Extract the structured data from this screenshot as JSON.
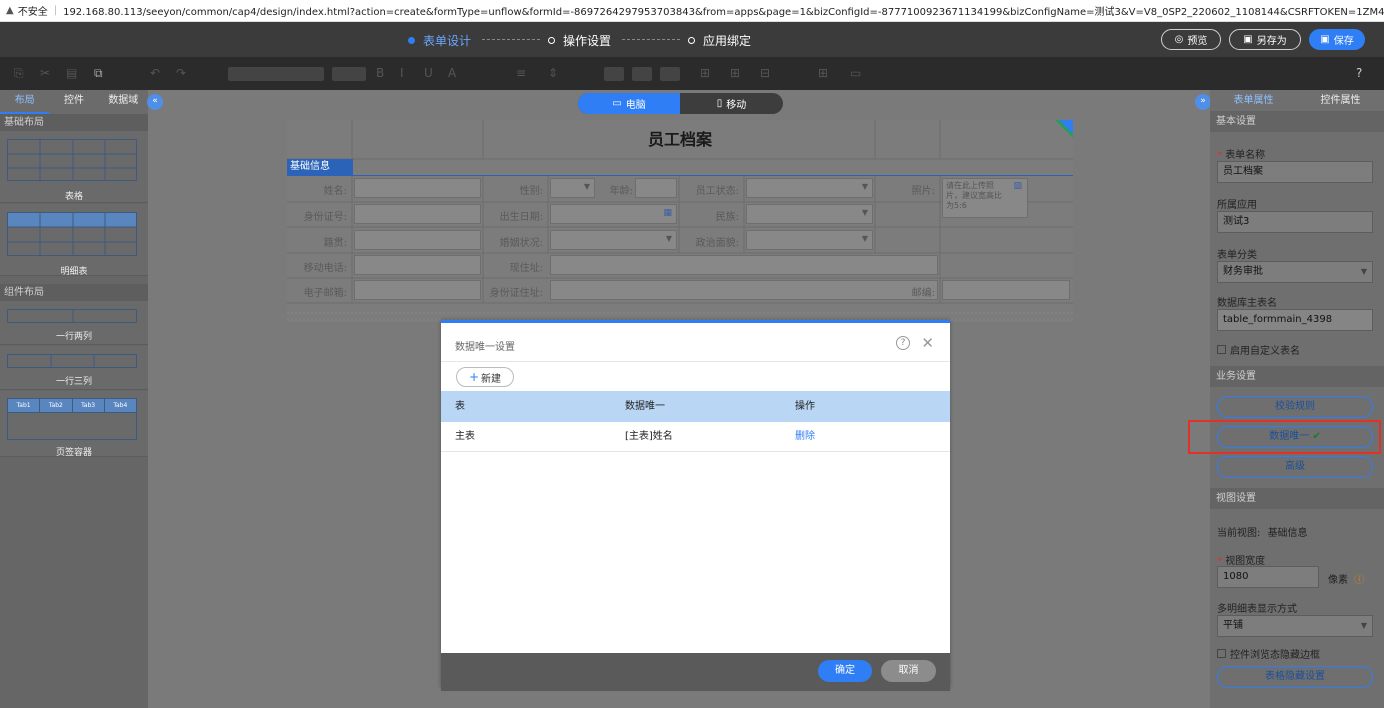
{
  "browser": {
    "security_label": "不安全",
    "url": "192.168.80.113/seeyon/common/cap4/design/index.html?action=create&formType=unflow&formId=-8697264297953703843&from=apps&page=1&bizConfigId=-8777100923671134199&bizConfigName=测试3&V=V8_0SP2_220602_1108144&CSRFTOKEN=1ZM4-..."
  },
  "steps": [
    {
      "label": "表单设计",
      "active": true
    },
    {
      "label": "操作设置",
      "active": false
    },
    {
      "label": "应用绑定",
      "active": false
    }
  ],
  "top_buttons": {
    "preview": "预览",
    "save_as": "另存为",
    "save": "保存"
  },
  "left_panel": {
    "tabs": [
      "布局",
      "控件",
      "数据域"
    ],
    "section_basic": "基础布局",
    "item_table": "表格",
    "item_detail_table": "明细表",
    "section_component": "组件布局",
    "item_two_col": "一行两列",
    "item_three_col": "一行三列",
    "tab_labels": [
      "Tab1",
      "Tab2",
      "Tab3",
      "Tab4"
    ],
    "item_tab_container": "页签容器"
  },
  "device_toggle": {
    "pc": "电脑",
    "mobile": "移动"
  },
  "form": {
    "title": "员工档案",
    "section": "基础信息",
    "labels": {
      "name": "姓名:",
      "gender": "性别:",
      "age": "年龄:",
      "status": "员工状态:",
      "photo": "照片:",
      "id_number": "身份证号:",
      "birth": "出生日期:",
      "ethnic": "民族:",
      "native": "籍贯:",
      "marital": "婚姻状况:",
      "political": "政治面貌:",
      "mobile": "移动电话:",
      "address": "现住址:",
      "email": "电子邮箱:",
      "id_address": "身份证住址:",
      "postcode": "邮编:"
    },
    "photo_hint": "请在此上传照片，建议宽高比为5:6"
  },
  "right_panel": {
    "tabs": [
      "表单属性",
      "控件属性"
    ],
    "section_basic": "基本设置",
    "form_name_label": "表单名称",
    "form_name_value": "员工档案",
    "app_label": "所属应用",
    "app_value": "测试3",
    "category_label": "表单分类",
    "category_value": "财务审批",
    "db_table_label": "数据库主表名",
    "db_table_value": "table_formmain_4398",
    "custom_table_name": "启用自定义表名",
    "section_business": "业务设置",
    "btn_validation": "校验规则",
    "btn_unique": "数据唯一",
    "btn_advanced": "高级",
    "section_view": "视图设置",
    "current_view_label": "当前视图:",
    "current_view_value": "基础信息",
    "view_width_label": "视图宽度",
    "view_width_value": "1080",
    "view_width_unit": "像素",
    "multi_detail_label": "多明细表显示方式",
    "multi_detail_value": "平铺",
    "hide_border": "控件浏览态隐藏边框",
    "btn_table_hide": "表格隐藏设置"
  },
  "dialog": {
    "title": "数据唯一设置",
    "new_button": "新建",
    "columns": [
      "表",
      "数据唯一",
      "操作"
    ],
    "rows": [
      {
        "table": "主表",
        "unique": "[主表]姓名",
        "action": "删除"
      }
    ],
    "ok": "确定",
    "cancel": "取消"
  }
}
